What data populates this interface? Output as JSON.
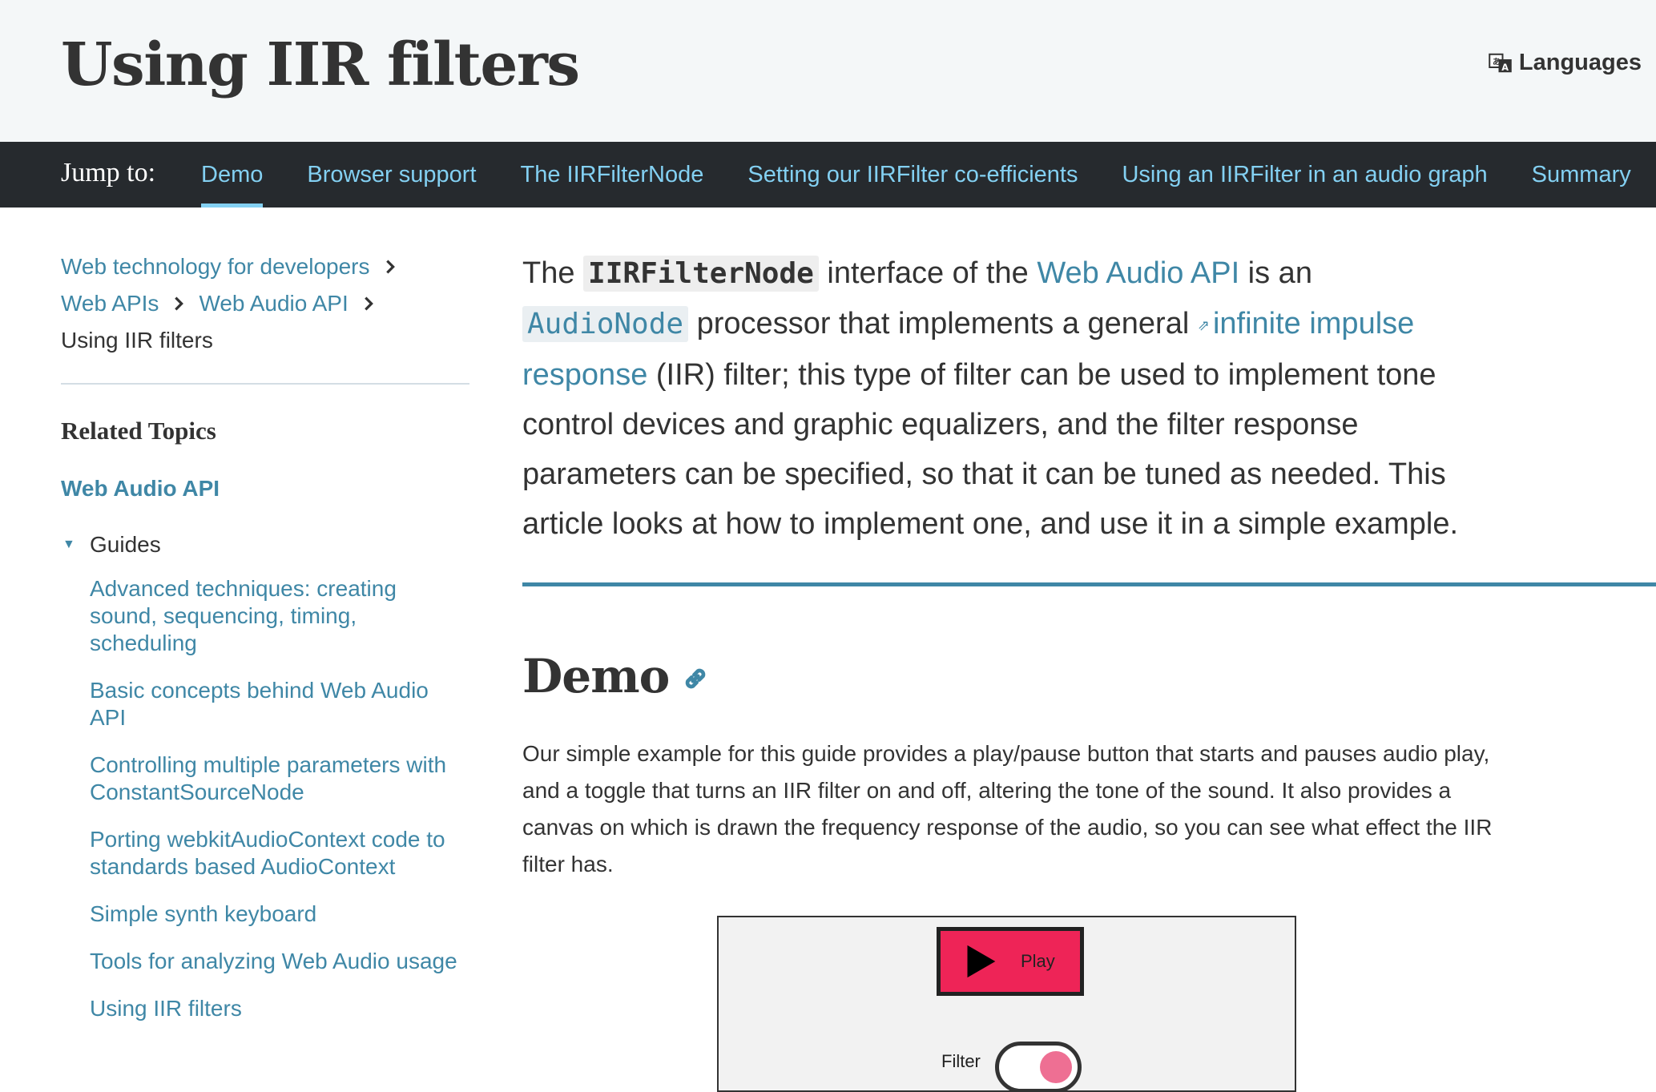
{
  "header": {
    "title": "Using IIR filters",
    "languages_label": "Languages",
    "languages_icon": "language-icon"
  },
  "jumpbar": {
    "label": "Jump to:",
    "links": [
      {
        "label": "Demo",
        "active": true
      },
      {
        "label": "Browser support"
      },
      {
        "label": "The IIRFilterNode"
      },
      {
        "label": "Setting our IIRFilter co-efficients"
      },
      {
        "label": "Using an IIRFilter in an audio graph"
      },
      {
        "label": "Summary"
      }
    ]
  },
  "sidebar": {
    "breadcrumbs": [
      {
        "label": "Web technology for developers"
      },
      {
        "label": "Web APIs"
      },
      {
        "label": "Web Audio API"
      },
      {
        "label": "Using IIR filters"
      }
    ],
    "related_heading": "Related Topics",
    "api_link": "Web Audio API",
    "guides_label": "Guides",
    "guides": [
      {
        "label": "Advanced techniques: creating sound, sequencing, timing, scheduling"
      },
      {
        "label": "Basic concepts behind Web Audio API"
      },
      {
        "label": "Controlling multiple parameters with ConstantSourceNode"
      },
      {
        "label": "Porting webkitAudioContext code to standards based AudioContext"
      },
      {
        "label": "Simple synth keyboard"
      },
      {
        "label": "Tools for analyzing Web Audio usage"
      },
      {
        "label": "Using IIR filters"
      }
    ]
  },
  "main": {
    "intro": {
      "t1": "The ",
      "code1": "IIRFilterNode",
      "t2": " interface of the ",
      "link1": "Web Audio API",
      "t3": " is an ",
      "code2": "AudioNode",
      "t4": " processor that implements a general ",
      "link2": "infinite impulse response",
      "t5": " (IIR) filter; this type of filter can be used to implement tone control devices and graphic equalizers, and the filter response parameters can be specified, so that it can be tuned as needed. This article looks at how to implement one, and use it in a simple example."
    },
    "demo_heading": "Demo",
    "demo_text": "Our simple example for this guide provides a play/pause button that starts and pauses audio play, and a toggle that turns an IIR filter on and off, altering the tone of the sound. It also provides a canvas on which is drawn the frequency response of the audio, so you can see what effect the IIR filter has.",
    "demo": {
      "play_label": "Play",
      "filter_label": "Filter",
      "filter_on": true,
      "accent": "#ee2457"
    }
  },
  "colors": {
    "link": "#3f87a6",
    "jump_link": "#83d0f2",
    "jumpbar_bg": "#262a2e",
    "header_bg": "#f4f7f8"
  }
}
